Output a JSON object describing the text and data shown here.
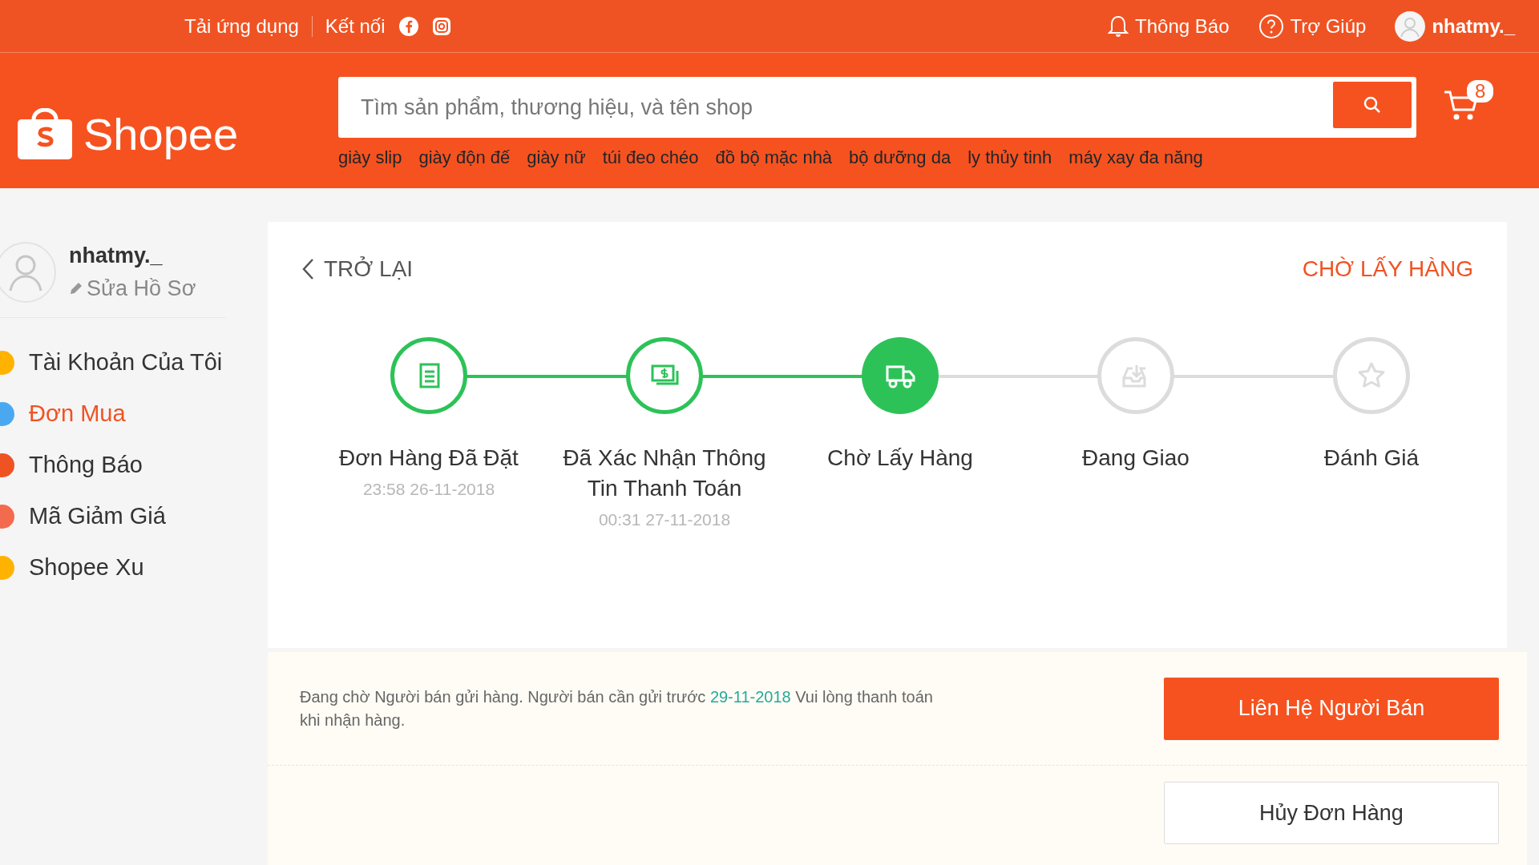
{
  "top_bar": {
    "left_links": [
      {
        "label": "Tải ứng dụng"
      },
      {
        "label": "Kết nối"
      }
    ],
    "right_links": [
      {
        "kind": "bell",
        "label": "Thông Báo"
      },
      {
        "kind": "help",
        "label": "Trợ Giúp"
      },
      {
        "kind": "user",
        "label": "nhatmy._"
      }
    ]
  },
  "header": {
    "logo": "Shopee",
    "search": {
      "placeholder": "Tìm sản phẩm, thương hiệu, và tên shop"
    },
    "cart_count": "8",
    "suggestions": [
      "giày slip",
      "giày độn đế",
      "giày nữ",
      "túi đeo chéo",
      "đồ bộ mặc nhà",
      "bộ dưỡng da",
      "ly thủy tinh",
      "máy xay đa năng"
    ]
  },
  "sidebar": {
    "username": "nhatmy._",
    "edit_profile": "Sửa Hồ Sơ",
    "items": [
      {
        "label": "Tài Khoản Của Tôi",
        "color": "#ffb300",
        "selected": false
      },
      {
        "label": "Đơn Mua",
        "color": "#4aa8f0",
        "selected": true
      },
      {
        "label": "Thông Báo",
        "color": "#f05323",
        "selected": false
      },
      {
        "label": "Mã Giảm Giá",
        "color": "#f46a4f",
        "selected": false
      },
      {
        "label": "Shopee Xu",
        "color": "#ffb300",
        "selected": false
      }
    ]
  },
  "order": {
    "back": "TRỞ LẠI",
    "status": "CHỜ LẤY HÀNG",
    "steps": [
      {
        "kind": "receipt",
        "label": "Đơn Hàng Đã Đặt",
        "time": "23:58 26-11-2018",
        "completed": true,
        "current": false
      },
      {
        "kind": "money",
        "label": "Đã Xác Nhận Thông Tin Thanh Toán",
        "time": "00:31 27-11-2018",
        "completed": true,
        "current": false
      },
      {
        "kind": "truck",
        "label": "Chờ Lấy Hàng",
        "completed": true,
        "current": true
      },
      {
        "kind": "inbox",
        "label": "Đang Giao",
        "completed": false,
        "current": false
      },
      {
        "kind": "star",
        "label": "Đánh Giá",
        "completed": false,
        "current": false
      }
    ],
    "notice": "Đang chờ Người bán gửi hàng. Người bán cần gửi trước **29-11-2018** Vui lòng thanh toán khi nhận hàng.",
    "buttons": [
      {
        "kind": "primary",
        "label": "Liên Hệ Người Bán"
      },
      {
        "kind": "outline",
        "label": "Hủy Đơn Hàng"
      }
    ]
  }
}
